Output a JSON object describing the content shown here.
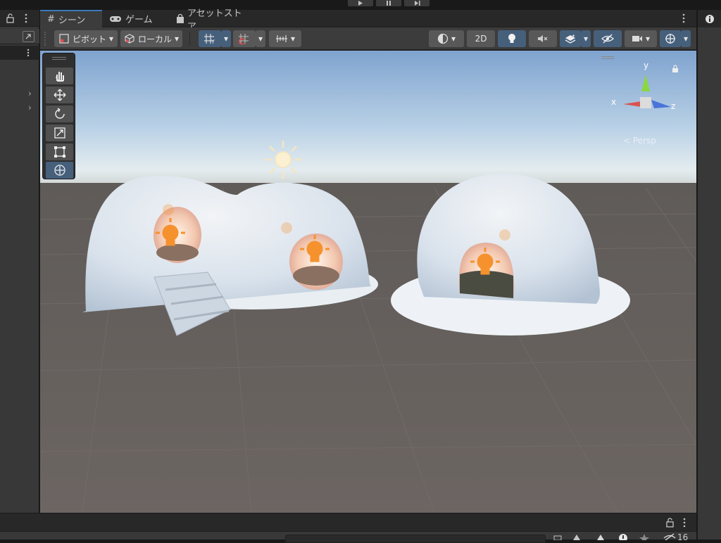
{
  "tabs": [
    {
      "label": "シーン",
      "icon": "grid-icon",
      "active": true
    },
    {
      "label": "ゲーム",
      "icon": "gamepad-icon",
      "active": false
    },
    {
      "label": "アセットストア",
      "icon": "bag-icon",
      "active": false
    }
  ],
  "toolbar": {
    "pivot_label": "ピボット",
    "local_label": "ローカル",
    "mode_2d_label": "2D"
  },
  "tools": [
    "hand-tool-icon",
    "move-tool-icon",
    "rotate-tool-icon",
    "scale-tool-icon",
    "rect-tool-icon",
    "transform-tool-icon"
  ],
  "gizmo": {
    "x_label": "x",
    "y_label": "y",
    "z_label": "z",
    "projection_label": "< Persp"
  },
  "bottom": {
    "count_label": "16"
  },
  "colors": {
    "accent": "#3a79bb",
    "active_button": "#46607c",
    "light_icon": "#f5922e"
  }
}
